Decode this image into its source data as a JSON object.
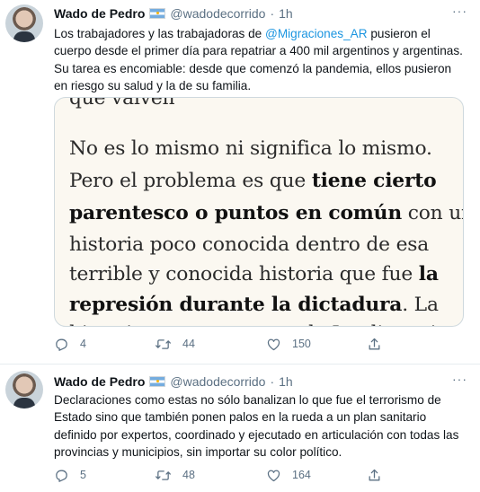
{
  "tweets": [
    {
      "author_name": "Wado de Pedro",
      "handle": "@wadodecorrido",
      "separator": "·",
      "time": "1h",
      "text_before": "Los trabajadores y las trabajadoras de ",
      "mention": "@Migraciones_AR",
      "text_after": " pusieron el cuerpo desde el primer día para repatriar a 400 mil argentinos y argentinas. Su tarea es encomiable: desde que comenzó la pandemia, ellos pusieron en riesgo su salud y la de su familia.",
      "media_lines": [
        {
          "parts": [
            {
              "text": "que vaivén",
              "bold": false
            }
          ]
        },
        {
          "parts": [
            {
              "text": "No es lo mismo ni significa lo mismo.",
              "bold": false
            }
          ]
        },
        {
          "parts": [
            {
              "text": "Pero el problema es que ",
              "bold": false
            },
            {
              "text": "tiene cierto",
              "bold": true
            }
          ]
        },
        {
          "parts": [
            {
              "text": "parentesco o puntos en común",
              "bold": true
            },
            {
              "text": " con una",
              "bold": false
            }
          ]
        },
        {
          "parts": [
            {
              "text": "historia poco conocida dentro de esa",
              "bold": false
            }
          ]
        },
        {
          "parts": [
            {
              "text": "terrible y conocida historia que fue ",
              "bold": false
            },
            {
              "text": "la",
              "bold": true
            }
          ]
        },
        {
          "parts": [
            {
              "text": "represión durante la dictadura",
              "bold": true
            },
            {
              "text": ". La",
              "bold": false
            }
          ]
        },
        {
          "parts": [
            {
              "text": "historia es que agentes de Inteligencia",
              "bold": false
            }
          ]
        }
      ],
      "reply_count": "4",
      "retweet_count": "44",
      "like_count": "150"
    },
    {
      "author_name": "Wado de Pedro",
      "handle": "@wadodecorrido",
      "separator": "·",
      "time": "1h",
      "text": "Declaraciones como estas no sólo banalizan lo que fue el terrorismo de Estado sino que también ponen palos en la rueda a un plan sanitario definido por expertos, coordinado y ejecutado en articulación con todas las provincias y municipios, sin importar su color político.",
      "reply_count": "5",
      "retweet_count": "48",
      "like_count": "164"
    }
  ],
  "more_label": "···",
  "colors": {
    "accent": "#1b95e0",
    "secondary_text": "#5b7083",
    "flag_blue": "#74acdf"
  },
  "icons": {
    "reply": "reply-icon",
    "retweet": "retweet-icon",
    "like": "heart-icon",
    "share": "share-icon",
    "more": "more-icon",
    "flag": "argentina-flag-icon"
  }
}
